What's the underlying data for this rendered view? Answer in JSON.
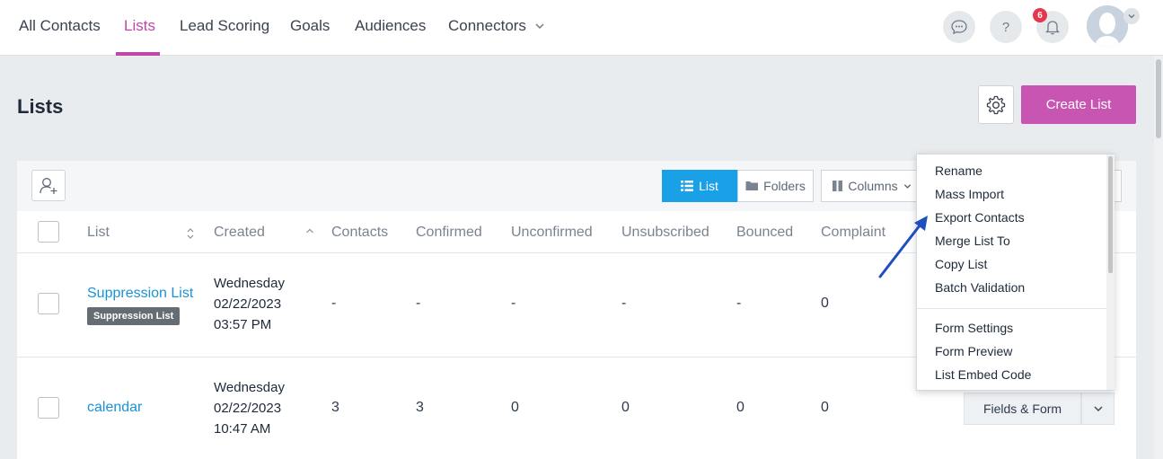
{
  "nav": {
    "items": [
      {
        "label": "All Contacts"
      },
      {
        "label": "Lists"
      },
      {
        "label": "Lead Scoring"
      },
      {
        "label": "Goals"
      },
      {
        "label": "Audiences"
      },
      {
        "label": "Connectors"
      }
    ],
    "active": "Lists",
    "help_label": "?",
    "notification_count": "6"
  },
  "header": {
    "title": "Lists",
    "create_button": "Create List"
  },
  "toolbar": {
    "view_list": "List",
    "view_folders": "Folders",
    "columns": "Columns"
  },
  "table": {
    "columns": [
      "List",
      "Created",
      "Contacts",
      "Confirmed",
      "Unconfirmed",
      "Unsubscribed",
      "Bounced",
      "Complaint"
    ],
    "rows": [
      {
        "name": "Suppression List",
        "tag": "Suppression List",
        "created": [
          "Wednesday",
          "02/22/2023",
          "03:57 PM"
        ],
        "contacts": "-",
        "confirmed": "-",
        "unconfirmed": "-",
        "unsubscribed": "-",
        "bounced": "-",
        "complaint": "0"
      },
      {
        "name": "calendar",
        "created": [
          "Wednesday",
          "02/22/2023",
          "10:47 AM"
        ],
        "contacts": "3",
        "confirmed": "3",
        "unconfirmed": "0",
        "unsubscribed": "0",
        "bounced": "0",
        "complaint": "0",
        "action": "Fields & Form"
      }
    ]
  },
  "menu": {
    "group1": [
      "Rename",
      "Mass Import",
      "Export Contacts",
      "Merge List To",
      "Copy List",
      "Batch Validation"
    ],
    "group2": [
      "Form Settings",
      "Form Preview",
      "List Embed Code"
    ]
  },
  "colors": {
    "accent": "#c245a8",
    "primary_button": "#c955b2",
    "link": "#1a93d5",
    "active_view": "#1aa0e6",
    "annotation_arrow": "#1f4fbf"
  }
}
